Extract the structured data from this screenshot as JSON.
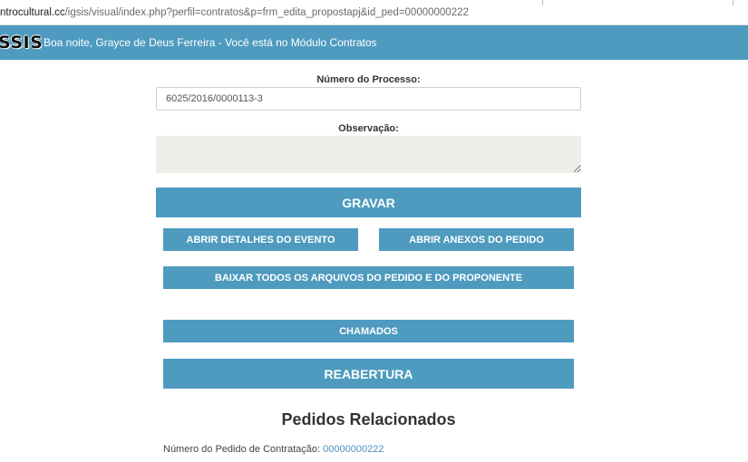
{
  "browser": {
    "url_host": "ntrocultural.cc",
    "url_path": "/igsis/visual/index.php?perfil=contratos&p=frm_edita_propostapj&id_ped=00000000222"
  },
  "header": {
    "logo": "SSIS",
    "greeting": "Boa noite, Grayce de Deus Ferreira - Você está no Módulo Contratos"
  },
  "form": {
    "process_label": "Número do Processo:",
    "process_value": "6025/2016/0000113-3",
    "observation_label": "Observação:",
    "observation_value": ""
  },
  "buttons": {
    "save": "GRAVAR",
    "event_details": "ABRIR DETALHES DO EVENTO",
    "order_attachments": "ABRIR ANEXOS DO PEDIDO",
    "download_all": "BAIXAR TODOS OS ARQUIVOS DO PEDIDO E DO PROPONENTE",
    "tickets": "CHAMADOS",
    "reopen": "REABERTURA"
  },
  "related": {
    "title": "Pedidos Relacionados",
    "order_label": "Número do Pedido de Contratação:",
    "order_number": "00000000222"
  },
  "colors": {
    "accent": "#4e9bbf",
    "textarea_bg": "#efeee8",
    "link": "#4e8fbf"
  }
}
